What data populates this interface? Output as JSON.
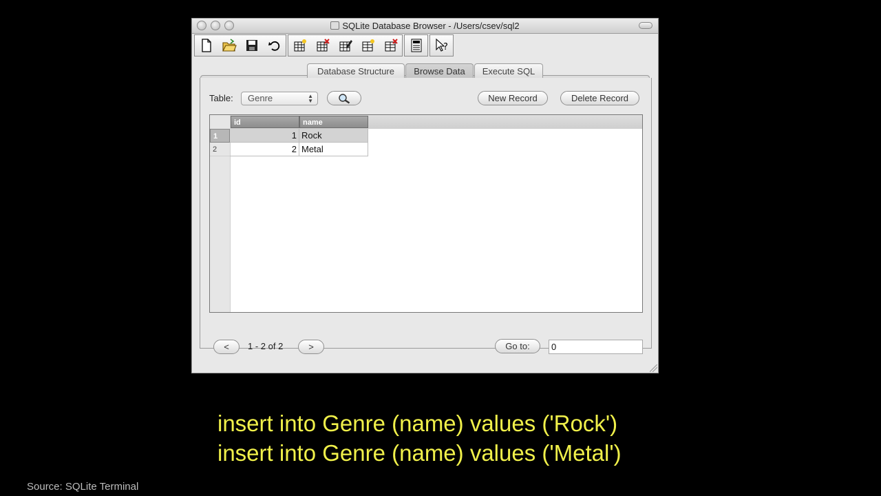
{
  "window": {
    "title": "SQLite Database Browser - /Users/csev/sql2"
  },
  "toolbar": {
    "buttons": [
      {
        "icon": "new-file-icon"
      },
      {
        "icon": "open-folder-icon"
      },
      {
        "icon": "save-icon"
      },
      {
        "icon": "undo-icon"
      },
      {
        "icon": "create-table-icon"
      },
      {
        "icon": "delete-table-icon"
      },
      {
        "icon": "modify-table-icon"
      },
      {
        "icon": "create-index-icon"
      },
      {
        "icon": "delete-index-icon"
      },
      {
        "icon": "log-icon"
      },
      {
        "icon": "whats-this-icon"
      }
    ]
  },
  "tabs": [
    {
      "label": "Database Structure",
      "active": false
    },
    {
      "label": "Browse Data",
      "active": true
    },
    {
      "label": "Execute SQL",
      "active": false
    }
  ],
  "browse": {
    "table_label": "Table:",
    "table_value": "Genre",
    "new_record": "New Record",
    "delete_record": "Delete Record",
    "columns": [
      "id",
      "name"
    ],
    "rows": [
      {
        "row_num": "1",
        "id": "1",
        "name": "Rock",
        "selected": true
      },
      {
        "row_num": "2",
        "id": "2",
        "name": "Metal",
        "selected": false
      }
    ],
    "prev": "<",
    "next": ">",
    "range": "1 - 2 of 2",
    "goto_label": "Go to:",
    "goto_value": "0"
  },
  "caption": {
    "line1": "insert into Genre (name) values ('Rock')",
    "line2": "insert into Genre (name) values ('Metal')"
  },
  "source": "Source: SQLite Terminal"
}
